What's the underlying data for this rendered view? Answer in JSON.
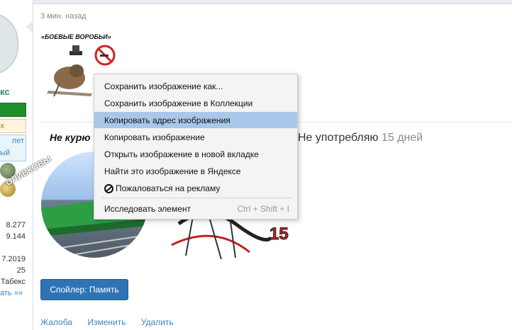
{
  "post": {
    "timestamp": "3 мин. назад",
    "signature_title": "«БОЕВЫЕ ВОРОБЬИ»",
    "quit_left": "Не курю",
    "quit_right_prefix": "Не употребляю",
    "quit_right_days": "15 дней",
    "train_caption": "ОЛИВКОВЫ",
    "spoiler_button": "Спойлер: Память",
    "footer_links": [
      "Жалоба",
      "Изменить",
      "Удалить"
    ]
  },
  "sidebar": {
    "username_fragment": "кс",
    "badge_orange": "к",
    "badge_blue_lines": [
      "лет",
      "ый"
    ],
    "stats": [
      "8.277",
      "9.144",
      "7.2019",
      "25",
      "Табекс"
    ],
    "more_link": "ать »»"
  },
  "context_menu": {
    "items": [
      {
        "label": "Сохранить изображение как...",
        "shortcut": ""
      },
      {
        "label": "Сохранить изображение в Коллекции",
        "shortcut": ""
      },
      {
        "label": "Копировать адрес изображения",
        "shortcut": "",
        "active": true
      },
      {
        "label": "Копировать изображение",
        "shortcut": ""
      },
      {
        "label": "Открыть изображение в новой вкладке",
        "shortcut": ""
      },
      {
        "label": "Найти это изображение в Яндексе",
        "shortcut": ""
      },
      {
        "label": "Пожаловаться на рекламу",
        "shortcut": "",
        "icon": "ban-icon"
      },
      {
        "label": "Исследовать элемент",
        "shortcut": "Ctrl + Shift + I"
      }
    ]
  },
  "colors": {
    "link": "#3a86c4",
    "button": "#2f73b6",
    "menu_highlight": "#a9c8e9"
  }
}
